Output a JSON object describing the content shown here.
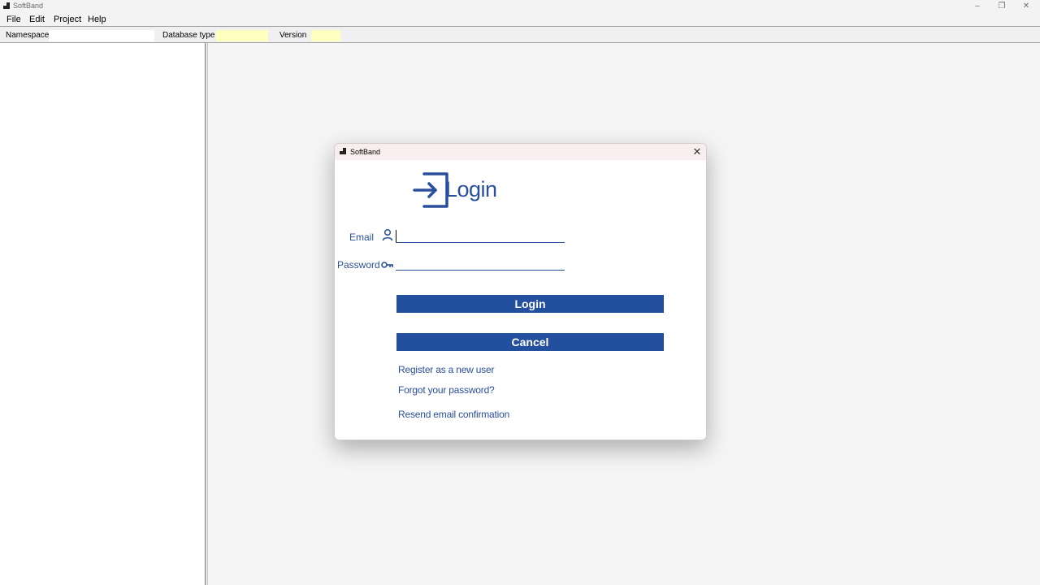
{
  "window": {
    "title": "SoftBand",
    "controls": [
      "minimize",
      "restore",
      "close"
    ]
  },
  "menubar": {
    "items": [
      "File",
      "Edit",
      "Project",
      "Help"
    ]
  },
  "toolbar": {
    "namespace_label": "Namespace",
    "namespace_value": "",
    "database_type_label": "Database type",
    "database_type_value": "",
    "version_label": "Version",
    "version_value": "",
    "highlight_color": "#ffffc0"
  },
  "dialog": {
    "title": "SoftBand",
    "heading": "Login",
    "heading_icon": "login-icon",
    "email_label": "Email",
    "email_icon": "user-icon",
    "email_value": "",
    "password_label": "Password",
    "password_icon": "key-icon",
    "password_value": "",
    "login_button": "Login",
    "cancel_button": "Cancel",
    "links": {
      "register": "Register as a new user",
      "forgot": "Forgot your password?",
      "resend": "Resend email confirmation"
    },
    "accent_color": "#234f9f"
  }
}
